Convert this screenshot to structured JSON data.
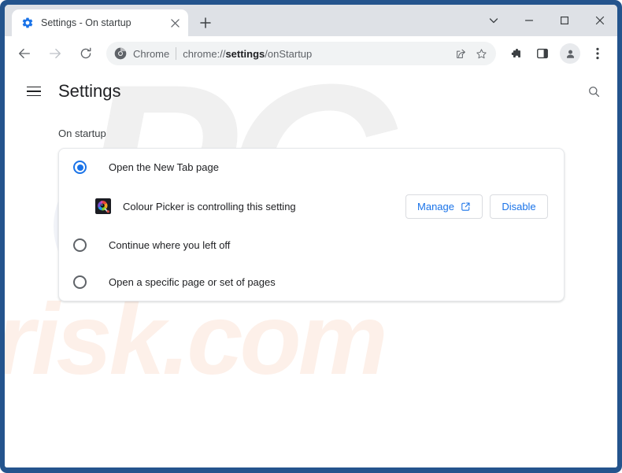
{
  "window": {
    "frame_color": "#24548d",
    "controls": {
      "minimize_tabs_label": "chevron-down",
      "minimize_label": "minimize",
      "maximize_label": "maximize",
      "close_label": "close"
    }
  },
  "tabstrip": {
    "tabs": [
      {
        "title": "Settings - On startup",
        "favicon": "gear-icon",
        "close_label": "close-tab"
      }
    ],
    "new_tab_label": "New tab"
  },
  "toolbar": {
    "back_label": "Back",
    "forward_label": "Forward",
    "reload_label": "Reload",
    "omnibox": {
      "chip_label": "Chrome",
      "url_prefix": "chrome://",
      "url_bold": "settings",
      "url_suffix": "/onStartup",
      "share_label": "Share this page",
      "bookmark_label": "Bookmark this tab"
    },
    "extensions_label": "Extensions",
    "side_panel_label": "Side panel",
    "profile_label": "Profile",
    "menu_label": "Customize and control Google Chrome"
  },
  "settings": {
    "menu_label": "Main menu",
    "title": "Settings",
    "search_label": "Search settings"
  },
  "main": {
    "section_label": "On startup",
    "options": [
      {
        "label": "Open the New Tab page",
        "checked": true
      },
      {
        "label": "Continue where you left off",
        "checked": false
      },
      {
        "label": "Open a specific page or set of pages",
        "checked": false
      }
    ],
    "extension_notice": {
      "icon": "colour-picker-extension-icon",
      "text": "Colour Picker is controlling this setting",
      "manage_label": "Manage",
      "manage_icon": "external-link-icon",
      "disable_label": "Disable"
    }
  },
  "watermark": {
    "top_text": "PC",
    "bottom_text": "risk.com",
    "top_color": "#f0f0f0",
    "bottom_color": "#fdf0e9"
  },
  "colors": {
    "accent": "#1a73e8",
    "frame": "#24548d",
    "tabstrip": "#dee1e6",
    "omnibox": "#f1f3f4",
    "text_primary": "#202124",
    "text_secondary": "#5f6368"
  }
}
